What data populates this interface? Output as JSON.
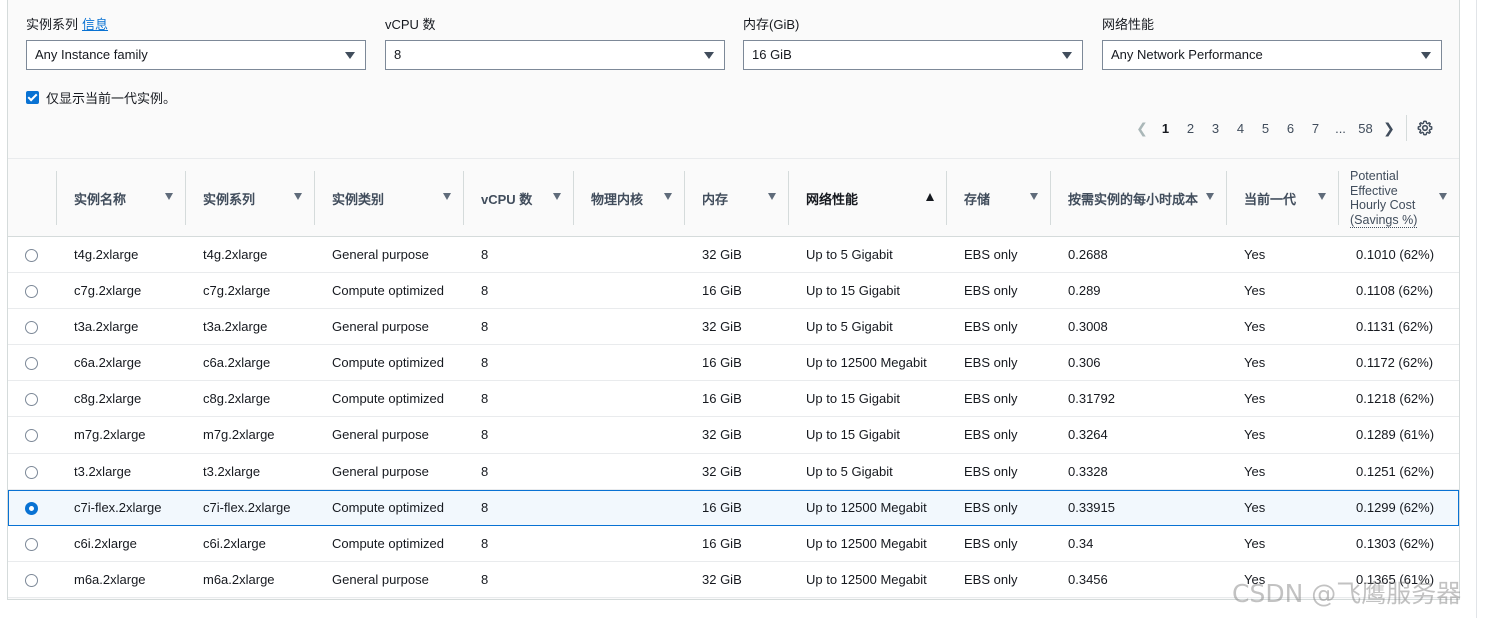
{
  "filters": [
    {
      "label": "实例系列",
      "info": "信息",
      "value": "Any Instance family"
    },
    {
      "label": "vCPU 数",
      "info": "",
      "value": "8"
    },
    {
      "label": "内存(GiB)",
      "info": "",
      "value": "16 GiB"
    },
    {
      "label": "网络性能",
      "info": "",
      "value": "Any Network Performance"
    }
  ],
  "current_gen_checkbox": {
    "label": "仅显示当前一代实例。",
    "checked": true
  },
  "pagination": {
    "pages": [
      "1",
      "2",
      "3",
      "4",
      "5",
      "6",
      "7"
    ],
    "ellipsis": "...",
    "last": "58",
    "current": "1"
  },
  "columns": [
    {
      "key": "name",
      "label": "实例名称"
    },
    {
      "key": "family",
      "label": "实例系列"
    },
    {
      "key": "type",
      "label": "实例类别"
    },
    {
      "key": "vcpu",
      "label": "vCPU 数"
    },
    {
      "key": "cores",
      "label": "物理内核"
    },
    {
      "key": "memory",
      "label": "内存"
    },
    {
      "key": "network",
      "label": "网络性能"
    },
    {
      "key": "storage",
      "label": "存储"
    },
    {
      "key": "cost",
      "label": "按需实例的每小时成本"
    },
    {
      "key": "current",
      "label": "当前一代"
    },
    {
      "key": "savings",
      "label_lines": [
        "Potential",
        "Effective",
        "Hourly Cost",
        "(Savings %)"
      ]
    }
  ],
  "rows": [
    {
      "name": "t4g.2xlarge",
      "family": "t4g.2xlarge",
      "type": "General purpose",
      "vcpu": "8",
      "cores": "",
      "memory": "32 GiB",
      "network": "Up to 5 Gigabit",
      "storage": "EBS only",
      "cost": "0.2688",
      "current": "Yes",
      "savings": "0.1010 (62%)",
      "selected": false
    },
    {
      "name": "c7g.2xlarge",
      "family": "c7g.2xlarge",
      "type": "Compute optimized",
      "vcpu": "8",
      "cores": "",
      "memory": "16 GiB",
      "network": "Up to 15 Gigabit",
      "storage": "EBS only",
      "cost": "0.289",
      "current": "Yes",
      "savings": "0.1108 (62%)",
      "selected": false
    },
    {
      "name": "t3a.2xlarge",
      "family": "t3a.2xlarge",
      "type": "General purpose",
      "vcpu": "8",
      "cores": "",
      "memory": "32 GiB",
      "network": "Up to 5 Gigabit",
      "storage": "EBS only",
      "cost": "0.3008",
      "current": "Yes",
      "savings": "0.1131 (62%)",
      "selected": false
    },
    {
      "name": "c6a.2xlarge",
      "family": "c6a.2xlarge",
      "type": "Compute optimized",
      "vcpu": "8",
      "cores": "",
      "memory": "16 GiB",
      "network": "Up to 12500 Megabit",
      "storage": "EBS only",
      "cost": "0.306",
      "current": "Yes",
      "savings": "0.1172 (62%)",
      "selected": false
    },
    {
      "name": "c8g.2xlarge",
      "family": "c8g.2xlarge",
      "type": "Compute optimized",
      "vcpu": "8",
      "cores": "",
      "memory": "16 GiB",
      "network": "Up to 15 Gigabit",
      "storage": "EBS only",
      "cost": "0.31792",
      "current": "Yes",
      "savings": "0.1218 (62%)",
      "selected": false
    },
    {
      "name": "m7g.2xlarge",
      "family": "m7g.2xlarge",
      "type": "General purpose",
      "vcpu": "8",
      "cores": "",
      "memory": "32 GiB",
      "network": "Up to 15 Gigabit",
      "storage": "EBS only",
      "cost": "0.3264",
      "current": "Yes",
      "savings": "0.1289 (61%)",
      "selected": false
    },
    {
      "name": "t3.2xlarge",
      "family": "t3.2xlarge",
      "type": "General purpose",
      "vcpu": "8",
      "cores": "",
      "memory": "32 GiB",
      "network": "Up to 5 Gigabit",
      "storage": "EBS only",
      "cost": "0.3328",
      "current": "Yes",
      "savings": "0.1251 (62%)",
      "selected": false
    },
    {
      "name": "c7i-flex.2xlarge",
      "family": "c7i-flex.2xlarge",
      "type": "Compute optimized",
      "vcpu": "8",
      "cores": "",
      "memory": "16 GiB",
      "network": "Up to 12500 Megabit",
      "storage": "EBS only",
      "cost": "0.33915",
      "current": "Yes",
      "savings": "0.1299 (62%)",
      "selected": true
    },
    {
      "name": "c6i.2xlarge",
      "family": "c6i.2xlarge",
      "type": "Compute optimized",
      "vcpu": "8",
      "cores": "",
      "memory": "16 GiB",
      "network": "Up to 12500 Megabit",
      "storage": "EBS only",
      "cost": "0.34",
      "current": "Yes",
      "savings": "0.1303 (62%)",
      "selected": false
    },
    {
      "name": "m6a.2xlarge",
      "family": "m6a.2xlarge",
      "type": "General purpose",
      "vcpu": "8",
      "cores": "",
      "memory": "32 GiB",
      "network": "Up to 12500 Megabit",
      "storage": "EBS only",
      "cost": "0.3456",
      "current": "Yes",
      "savings": "0.1365 (61%)",
      "selected": false
    }
  ],
  "watermark": "CSDN @飞鹰服务器",
  "colors": {
    "accent": "#0972d3",
    "text": "#16191f",
    "border": "#d5dbdb"
  }
}
